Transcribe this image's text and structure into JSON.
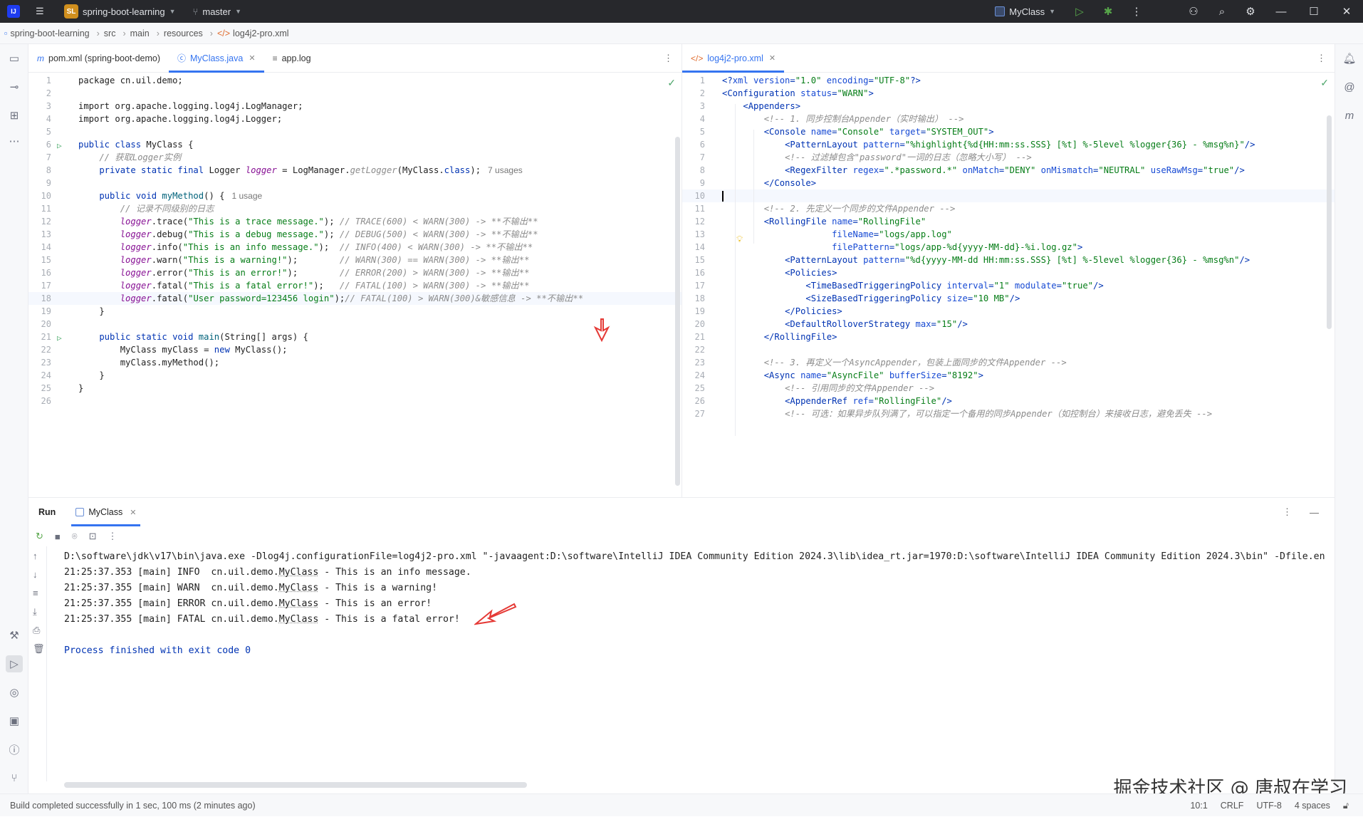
{
  "titlebar": {
    "project_badge": "SL",
    "project_name": "spring-boot-learning",
    "branch": "master",
    "run_config": "MyClass"
  },
  "breadcrumb": [
    "spring-boot-learning",
    "src",
    "main",
    "resources",
    "log4j2-pro.xml"
  ],
  "left_editor": {
    "tabs": [
      {
        "label": "pom.xml (spring-boot-demo)",
        "icon": "maven-icon"
      },
      {
        "label": "MyClass.java",
        "icon": "java-class-icon",
        "active": true
      },
      {
        "label": "app.log",
        "icon": "text-file-icon"
      }
    ],
    "hints": {
      "usages_logger": "7 usages",
      "usages_method": "1 usage"
    },
    "line_numbers": [
      "1",
      "2",
      "3",
      "4",
      "5",
      "6",
      "7",
      "8",
      "9",
      "10",
      "11",
      "12",
      "13",
      "14",
      "15",
      "16",
      "17",
      "18",
      "19",
      "20",
      "21",
      "22",
      "23",
      "24",
      "25",
      "26"
    ],
    "code": {
      "l1": "package cn.uil.demo;",
      "l3": "import org.apache.logging.log4j.LogManager;",
      "l4": "import org.apache.logging.log4j.Logger;",
      "l6_kw": "public class",
      "l6_name": " MyClass {",
      "l7": "    // 获取Logger实例",
      "l8_kw": "    private static final",
      "l8_type": " Logger ",
      "l8_field": "logger",
      "l8_rest": " = LogManager.",
      "l8_method": "getLogger",
      "l8_rest2": "(MyClass.",
      "l8_kw2": "class",
      "l8_end": ");",
      "l10_kw": "    public void",
      "l10_name": " myMethod",
      "l10_end": "() {",
      "l11": "        // 记录不同级别的日志",
      "logs": [
        {
          "call": ".trace(",
          "str": "\"This is a trace message.\"",
          "end": "); ",
          "comment": "// TRACE(600) < WARN(300) -> **不输出**"
        },
        {
          "call": ".debug(",
          "str": "\"This is a debug message.\"",
          "end": "); ",
          "comment": "// DEBUG(500) < WARN(300) -> **不输出**"
        },
        {
          "call": ".info(",
          "str": "\"This is an info message.\"",
          "end": ");  ",
          "comment": "// INFO(400) < WARN(300) -> **不输出**"
        },
        {
          "call": ".warn(",
          "str": "\"This is a warning!\"",
          "end": ");        ",
          "comment": "// WARN(300) == WARN(300) -> **输出**"
        },
        {
          "call": ".error(",
          "str": "\"This is an error!\"",
          "end": ");        ",
          "comment": "// ERROR(200) > WARN(300) -> **输出**"
        },
        {
          "call": ".fatal(",
          "str": "\"This is a fatal error!\"",
          "end": ");   ",
          "comment": "// FATAL(100) > WARN(300) -> **输出**"
        },
        {
          "call": ".fatal(",
          "str": "\"User password=123456 login\"",
          "end": ");",
          "comment": "// FATAL(100) > WARN(300)&敏感信息 -> **不输出**"
        }
      ],
      "l19": "    }",
      "l21_kw": "    public static void",
      "l21_name": " main",
      "l21_end": "(String[] args) {",
      "l22_a": "        MyClass myClass = ",
      "l22_kw": "new",
      "l22_b": " MyClass();",
      "l23": "        myClass.myMethod();",
      "l24": "    }",
      "l25": "}"
    }
  },
  "right_editor": {
    "tabs": [
      {
        "label": "log4j2-pro.xml",
        "icon": "xml-icon",
        "active": true
      }
    ],
    "line_numbers": [
      "1",
      "2",
      "3",
      "4",
      "5",
      "6",
      "7",
      "8",
      "9",
      "10",
      "11",
      "12",
      "13",
      "14",
      "15",
      "16",
      "17",
      "18",
      "19",
      "20",
      "21",
      "22",
      "23",
      "24",
      "25",
      "26",
      "27"
    ],
    "lines": [
      [
        [
          "t",
          "<?"
        ],
        [
          "a",
          "xml version"
        ],
        [
          "t",
          "="
        ],
        [
          "s",
          "\"1.0\""
        ],
        [
          "a",
          " encoding"
        ],
        [
          "t",
          "="
        ],
        [
          "s",
          "\"UTF-8\""
        ],
        [
          "t",
          "?>"
        ]
      ],
      [
        [
          "t",
          "<Configuration "
        ],
        [
          "a",
          "status"
        ],
        [
          "t",
          "="
        ],
        [
          "s",
          "\"WARN\""
        ],
        [
          "t",
          ">"
        ]
      ],
      [
        [
          "p",
          "    "
        ],
        [
          "t",
          "<Appenders>"
        ]
      ],
      [
        [
          "p",
          "        "
        ],
        [
          "c",
          "<!-- 1. 同步控制台Appender（实时输出） -->"
        ]
      ],
      [
        [
          "p",
          "        "
        ],
        [
          "t",
          "<Console "
        ],
        [
          "a",
          "name"
        ],
        [
          "t",
          "="
        ],
        [
          "s",
          "\"Console\""
        ],
        [
          "a",
          " target"
        ],
        [
          "t",
          "="
        ],
        [
          "s",
          "\"SYSTEM_OUT\""
        ],
        [
          "t",
          ">"
        ]
      ],
      [
        [
          "p",
          "            "
        ],
        [
          "t",
          "<PatternLayout "
        ],
        [
          "a",
          "pattern"
        ],
        [
          "t",
          "="
        ],
        [
          "s",
          "\"%highlight{%d{HH:mm:ss.SSS} [%t] %-5level %logger{36} - %msg%n}\""
        ],
        [
          "t",
          "/>"
        ]
      ],
      [
        [
          "p",
          "            "
        ],
        [
          "c",
          "<!-- 过滤掉包含\"password\"一词的日志（忽略大小写） -->"
        ]
      ],
      [
        [
          "p",
          "            "
        ],
        [
          "t",
          "<RegexFilter "
        ],
        [
          "a",
          "regex"
        ],
        [
          "t",
          "="
        ],
        [
          "s",
          "\".*password.*\""
        ],
        [
          "a",
          " onMatch"
        ],
        [
          "t",
          "="
        ],
        [
          "s",
          "\"DENY\""
        ],
        [
          "a",
          " onMismatch"
        ],
        [
          "t",
          "="
        ],
        [
          "s",
          "\"NEUTRAL\""
        ],
        [
          "a",
          " useRawMsg"
        ],
        [
          "t",
          "="
        ],
        [
          "s",
          "\"true\""
        ],
        [
          "t",
          "/>"
        ]
      ],
      [
        [
          "p",
          "        "
        ],
        [
          "t",
          "</Console>"
        ]
      ],
      [
        [
          "p",
          ""
        ]
      ],
      [
        [
          "p",
          "        "
        ],
        [
          "c",
          "<!-- 2. 先定义一个同步的文件Appender -->"
        ]
      ],
      [
        [
          "p",
          "        "
        ],
        [
          "t",
          "<RollingFile "
        ],
        [
          "a",
          "name"
        ],
        [
          "t",
          "="
        ],
        [
          "s",
          "\"RollingFile\""
        ]
      ],
      [
        [
          "p",
          "                     "
        ],
        [
          "a",
          "fileName"
        ],
        [
          "t",
          "="
        ],
        [
          "s",
          "\"logs/app.log\""
        ]
      ],
      [
        [
          "p",
          "                     "
        ],
        [
          "a",
          "filePattern"
        ],
        [
          "t",
          "="
        ],
        [
          "s",
          "\"logs/app-%d{yyyy-MM-dd}-%i.log.gz\""
        ],
        [
          "t",
          ">"
        ]
      ],
      [
        [
          "p",
          "            "
        ],
        [
          "t",
          "<PatternLayout "
        ],
        [
          "a",
          "pattern"
        ],
        [
          "t",
          "="
        ],
        [
          "s",
          "\"%d{yyyy-MM-dd HH:mm:ss.SSS} [%t] %-5level %logger{36} - %msg%n\""
        ],
        [
          "t",
          "/>"
        ]
      ],
      [
        [
          "p",
          "            "
        ],
        [
          "t",
          "<Policies>"
        ]
      ],
      [
        [
          "p",
          "                "
        ],
        [
          "t",
          "<TimeBasedTriggeringPolicy "
        ],
        [
          "a",
          "interval"
        ],
        [
          "t",
          "="
        ],
        [
          "s",
          "\"1\""
        ],
        [
          "a",
          " modulate"
        ],
        [
          "t",
          "="
        ],
        [
          "s",
          "\"true\""
        ],
        [
          "t",
          "/>"
        ]
      ],
      [
        [
          "p",
          "                "
        ],
        [
          "t",
          "<SizeBasedTriggeringPolicy "
        ],
        [
          "a",
          "size"
        ],
        [
          "t",
          "="
        ],
        [
          "s",
          "\"10 MB\""
        ],
        [
          "t",
          "/>"
        ]
      ],
      [
        [
          "p",
          "            "
        ],
        [
          "t",
          "</Policies>"
        ]
      ],
      [
        [
          "p",
          "            "
        ],
        [
          "t",
          "<DefaultRolloverStrategy "
        ],
        [
          "a",
          "max"
        ],
        [
          "t",
          "="
        ],
        [
          "s",
          "\"15\""
        ],
        [
          "t",
          "/>"
        ]
      ],
      [
        [
          "p",
          "        "
        ],
        [
          "t",
          "</RollingFile>"
        ]
      ],
      [
        [
          "p",
          ""
        ]
      ],
      [
        [
          "p",
          "        "
        ],
        [
          "c",
          "<!-- 3. 再定义一个AsyncAppender，包装上面同步的文件Appender -->"
        ]
      ],
      [
        [
          "p",
          "        "
        ],
        [
          "t",
          "<Async "
        ],
        [
          "a",
          "name"
        ],
        [
          "t",
          "="
        ],
        [
          "s",
          "\"AsyncFile\""
        ],
        [
          "a",
          " bufferSize"
        ],
        [
          "t",
          "="
        ],
        [
          "s",
          "\"8192\""
        ],
        [
          "t",
          ">"
        ]
      ],
      [
        [
          "p",
          "            "
        ],
        [
          "c",
          "<!-- 引用同步的文件Appender -->"
        ]
      ],
      [
        [
          "p",
          "            "
        ],
        [
          "t",
          "<AppenderRef "
        ],
        [
          "a",
          "ref"
        ],
        [
          "t",
          "="
        ],
        [
          "s",
          "\"RollingFile\""
        ],
        [
          "t",
          "/>"
        ]
      ],
      [
        [
          "p",
          "            "
        ],
        [
          "c",
          "<!-- 可选：如果异步队列满了，可以指定一个备用的同步Appender（如控制台）来接收日志，避免丢失 -->"
        ]
      ]
    ]
  },
  "run_panel": {
    "title": "Run",
    "tab": "MyClass",
    "command": "D:\\software\\jdk\\v17\\bin\\java.exe -Dlog4j.configurationFile=log4j2-pro.xml \"-javaagent:D:\\software\\IntelliJ IDEA Community Edition 2024.3\\lib\\idea_rt.jar=1970:D:\\software\\IntelliJ IDEA Community Edition 2024.3\\bin\" -Dfile.en",
    "log_lines": [
      {
        "prefix": "21:25:37.353 [main] INFO  cn.uil.demo.",
        "cls": "MyClass",
        "msg": " - This is an info message."
      },
      {
        "prefix": "21:25:37.355 [main] WARN  cn.uil.demo.",
        "cls": "MyClass",
        "msg": " - This is a warning!"
      },
      {
        "prefix": "21:25:37.355 [main] ERROR cn.uil.demo.",
        "cls": "MyClass",
        "msg": " - This is an error!"
      },
      {
        "prefix": "21:25:37.355 [main] FATAL cn.uil.demo.",
        "cls": "MyClass",
        "msg": " - This is a fatal error!"
      }
    ],
    "exit_message": "Process finished with exit code 0"
  },
  "statusbar": {
    "message": "Build completed successfully in 1 sec, 100 ms (2 minutes ago)",
    "position": "10:1",
    "line_sep": "CRLF",
    "encoding": "UTF-8",
    "indent": "4 spaces"
  },
  "watermark": "掘金技术社区 @ 唐叔在学习",
  "colors": {
    "accent": "#3574f0",
    "titlebar": "#27282c",
    "keyword": "#0033b3",
    "string": "#067d17",
    "annotation_arrow": "#e53935"
  }
}
